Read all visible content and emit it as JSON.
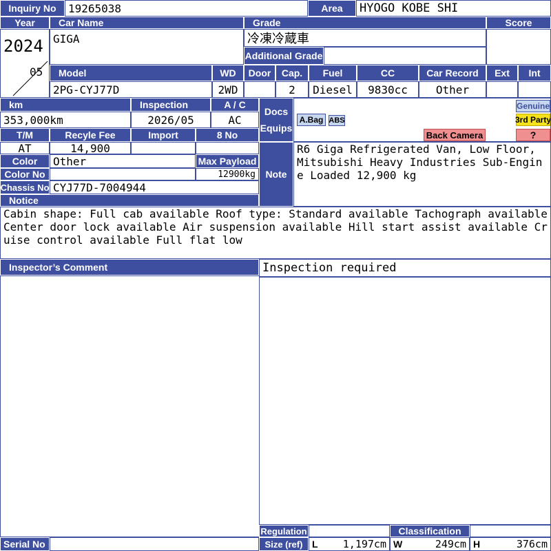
{
  "labels": {
    "inquiry_no": "Inquiry No",
    "area": "Area",
    "year": "Year",
    "car_name": "Car Name",
    "grade": "Grade",
    "score": "Score",
    "additional_grade": "Additional Grade",
    "model": "Model",
    "wd": "WD",
    "door": "Door",
    "cap": "Cap.",
    "fuel": "Fuel",
    "cc": "CC",
    "car_record": "Car Record",
    "ext": "Ext",
    "int": "Int",
    "km": "km",
    "inspection": "Inspection",
    "ac": "A / C",
    "docs": "Docs",
    "equips": "Equips",
    "tm": "T/M",
    "recycle_fee": "Recyle Fee",
    "import": "Import",
    "eight_no": "8 No",
    "color": "Color",
    "max_payload": "Max Payload",
    "color_no": "Color No",
    "chassis_no": "Chassis No",
    "note": "Note",
    "notice": "Notice",
    "inspectors_comment": "Inspector’s Comment",
    "regulation": "Regulation",
    "classification": "Classification",
    "size_ref": "Size (ref)",
    "serial_no": "Serial No",
    "l": "L",
    "w": "W",
    "h": "H"
  },
  "values": {
    "inquiry_no": "19265038",
    "area": "HYOGO KOBE SHI",
    "year": "2024",
    "month": "05",
    "car_name": "GIGA",
    "grade": "冷凍冷蔵車",
    "additional_grade": "",
    "score": "",
    "model": "2PG-CYJ77D",
    "wd": "2WD",
    "door": "",
    "cap": "2",
    "fuel": "Diesel",
    "cc": "9830cc",
    "car_record": "Other",
    "ext": "",
    "int": "",
    "km": "353,000km",
    "inspection": "2026/05",
    "ac": "AC",
    "tm": "AT",
    "recycle_fee": "14,900",
    "import": "",
    "eight_no": "",
    "color": "Other",
    "max_payload": "12900kg",
    "color_no": "",
    "chassis_no": "CYJ77D-7004944",
    "note": "R6 Giga Refrigerated Van, Low Floor, Mitsubishi Heavy Industries Sub-Engine Loaded 12,900 kg",
    "notice": "Cabin shape: Full cab available Roof type: Standard available Tachograph available Center door lock available Air suspension available Hill start assist available Cruise control available Full flat low",
    "inspectors_comment": "Inspection required",
    "regulation": "",
    "classification": "",
    "serial_no": "",
    "size_l": "1,197cm",
    "size_w": "249cm",
    "size_h": "376cm"
  },
  "badges": {
    "abag": "A.Bag",
    "abs": "ABS",
    "back_camera": "Back Camera",
    "genuine": "Genuine",
    "third_party": "3rd Party",
    "unknown": "?"
  },
  "colors": {
    "header": "#3f4f9f",
    "badge_blue": "#c6d6ef",
    "badge_yellow": "#f6e21a",
    "badge_red": "#f08f8f"
  }
}
